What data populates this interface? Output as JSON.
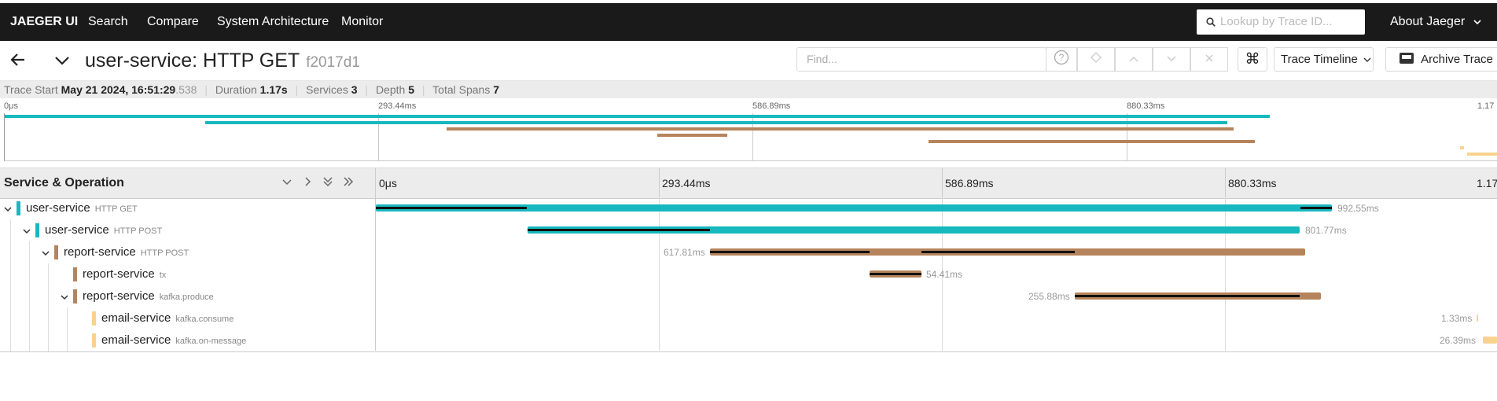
{
  "nav": {
    "brand": "JAEGER UI",
    "links": [
      "Search",
      "Compare",
      "System Architecture",
      "Monitor"
    ],
    "search_placeholder": "Lookup by Trace ID...",
    "about": "About Jaeger"
  },
  "header": {
    "title": "user-service: HTTP GET",
    "trace_id": "f2017d1",
    "find_placeholder": "Find...",
    "view_select": "Trace Timeline",
    "archive": "Archive Trace"
  },
  "meta": {
    "start_label": "Trace Start",
    "start_date": "May 21 2024, 16:51:29",
    "start_ms": ".538",
    "duration_label": "Duration",
    "duration": "1.17s",
    "services_label": "Services",
    "services": "3",
    "depth_label": "Depth",
    "depth": "5",
    "spans_label": "Total Spans",
    "spans": "7"
  },
  "minimap": {
    "ticks": [
      "0μs",
      "293.44ms",
      "586.89ms",
      "880.33ms",
      "1.17"
    ]
  },
  "timeline": {
    "header_label": "Service & Operation",
    "ticks": [
      "0μs",
      "293.44ms",
      "586.89ms",
      "880.33ms",
      "1.17"
    ]
  },
  "colors": {
    "user-service": "#17b8be",
    "report-service": "#b6845c",
    "email-service": "#f8d38f"
  },
  "spans": [
    {
      "service": "user-service",
      "operation": "HTTP GET",
      "duration_label": "992.55ms"
    },
    {
      "service": "user-service",
      "operation": "HTTP POST",
      "duration_label": "801.77ms"
    },
    {
      "service": "report-service",
      "operation": "HTTP POST",
      "duration_label": "617.81ms"
    },
    {
      "service": "report-service",
      "operation": "tx",
      "duration_label": "54.41ms"
    },
    {
      "service": "report-service",
      "operation": "kafka.produce",
      "duration_label": "255.88ms"
    },
    {
      "service": "email-service",
      "operation": "kafka.consume",
      "duration_label": "1.33ms"
    },
    {
      "service": "email-service",
      "operation": "kafka.on-message",
      "duration_label": "26.39ms"
    }
  ]
}
